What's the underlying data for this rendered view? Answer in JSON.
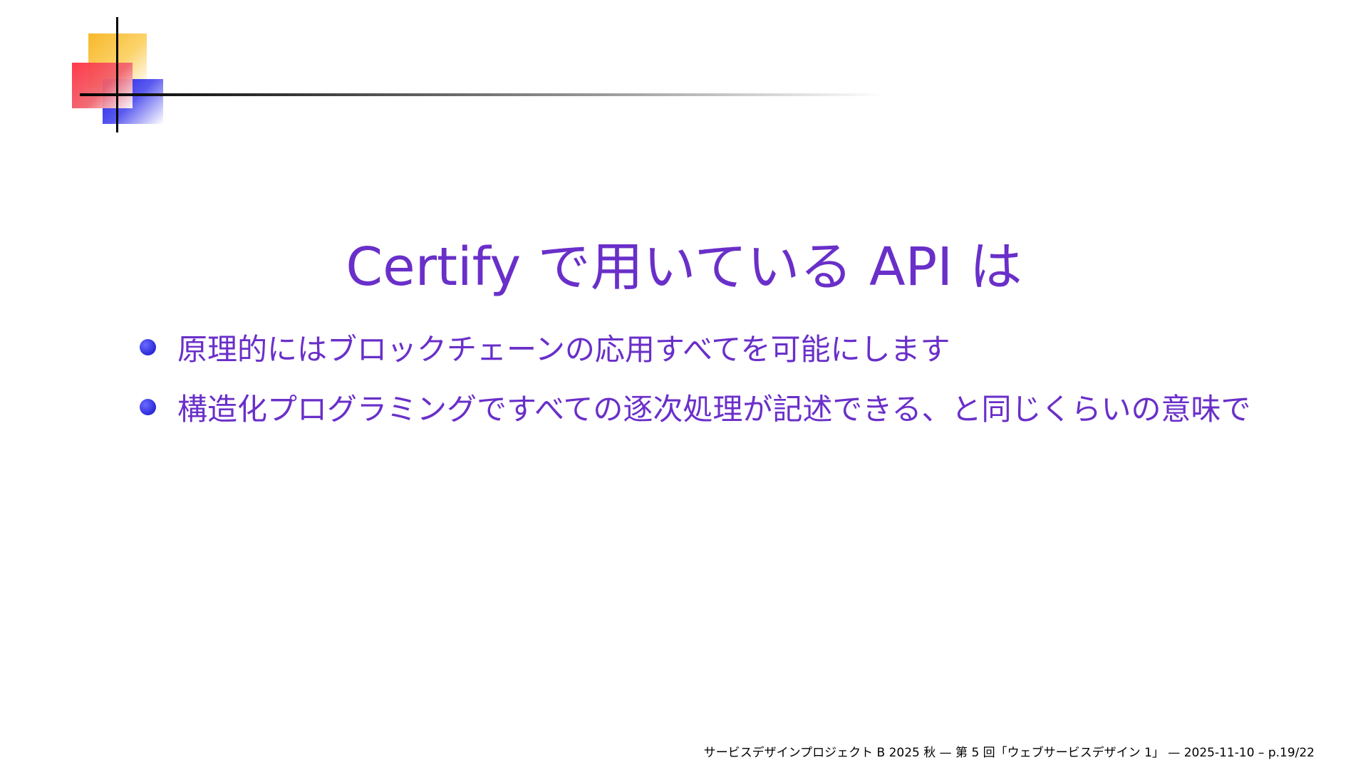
{
  "slide": {
    "title": "Certify で用いている API は",
    "bullets": [
      "原理的にはブロックチェーンの応用すべてを可能にします",
      "構造化プログラミングですべての逐次処理が記述できる、と同じくらいの意味で"
    ],
    "footer": "サービスデザインプロジェクト B 2025 秋 — 第 5 回「ウェブサービスデザイン 1」 — 2025-11-10 – p.19/22"
  },
  "colors": {
    "title_text": "#6a2fc9",
    "bullet_text": "#6a2fc9",
    "bullet_dot": "#2a2ad8",
    "logo_yellow": "#f7b82a",
    "logo_red": "#ff3040",
    "logo_blue": "#1a1ae6"
  }
}
